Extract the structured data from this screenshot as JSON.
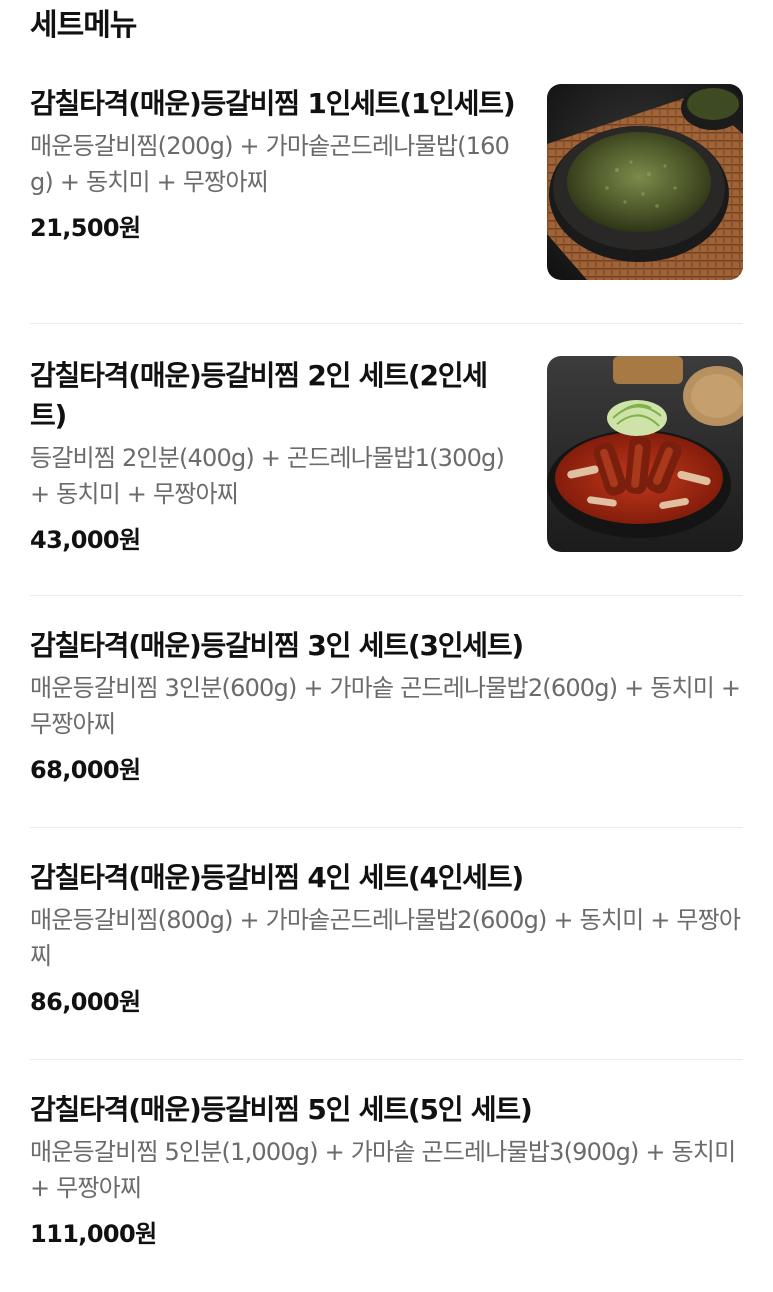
{
  "section": {
    "title": "세트메뉴"
  },
  "menu": [
    {
      "name": "감칠타격(매운)등갈비찜 1인세트(1인세트)",
      "description": "매운등갈비찜(200g) + 가마솥곤드레나물밥(160g) + 동치미 + 무짱아찌",
      "price": "21,500원",
      "image": "gondre-rice-pot-photo"
    },
    {
      "name": "감칠타격(매운)등갈비찜 2인 세트(2인세트)",
      "description": "등갈비찜 2인분(400g) + 곤드레나물밥1(300g) + 동치미 + 무짱아찌",
      "price": "43,000원",
      "image": "spicy-rib-stew-photo"
    },
    {
      "name": "감칠타격(매운)등갈비찜 3인 세트(3인세트)",
      "description": "매운등갈비찜 3인분(600g) + 가마솥 곤드레나물밥2(600g) + 동치미 + 무짱아찌",
      "price": "68,000원"
    },
    {
      "name": "감칠타격(매운)등갈비찜 4인 세트(4인세트)",
      "description": "매운등갈비찜(800g) + 가마솥곤드레나물밥2(600g) + 동치미 + 무짱아찌",
      "price": "86,000원"
    },
    {
      "name": "감칠타격(매운)등갈비찜 5인 세트(5인 세트)",
      "description": "매운등갈비찜 5인분(1,000g) + 가마솥 곤드레나물밥3(900g) + 동치미 + 무짱아찌",
      "price": "111,000원"
    }
  ]
}
